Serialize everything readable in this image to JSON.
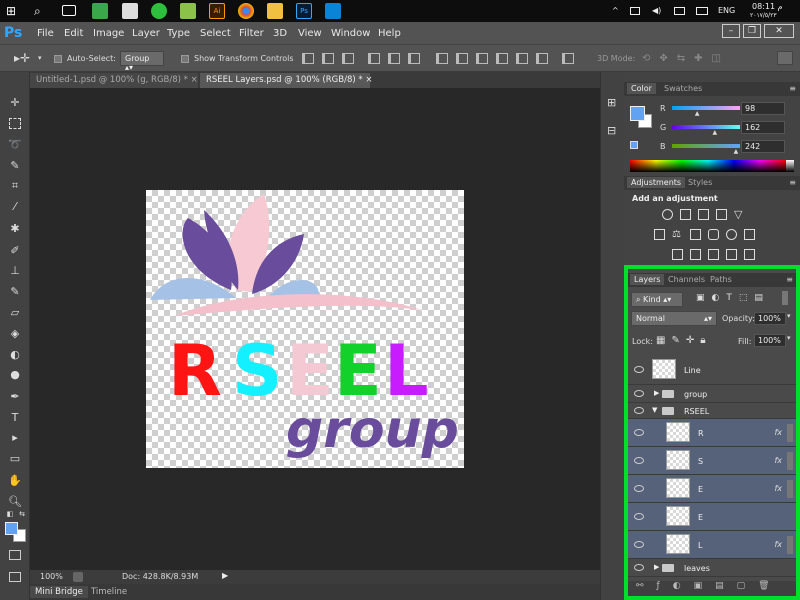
{
  "taskbar": {
    "icons": [
      "windows-icon",
      "search-icon",
      "task-view-icon",
      "folder-icon",
      "calculator-icon",
      "whatsapp-icon",
      "paint-icon",
      "illustrator-icon",
      "chrome-icon",
      "explorer-icon",
      "photoshop-icon",
      "photos-icon"
    ],
    "language": "ENG",
    "time": "08:11 م",
    "date": "٢٠١٧/٥/٢٣"
  },
  "menu": {
    "logo": "Ps",
    "items": [
      "File",
      "Edit",
      "Image",
      "Layer",
      "Type",
      "Select",
      "Filter",
      "3D",
      "View",
      "Window",
      "Help"
    ]
  },
  "options": {
    "auto_select_label": "Auto-Select:",
    "auto_select_value": "Group",
    "show_transform_label": "Show Transform Controls",
    "mode_3d_label": "3D Mode:"
  },
  "tabs": [
    {
      "label": "Untitled-1.psd @ 100% (g, RGB/8) *",
      "active": false
    },
    {
      "label": "RSEEL Layers.psd @ 100% (RGB/8) *",
      "active": true
    }
  ],
  "artwork": {
    "letters": [
      {
        "char": "R",
        "color": "#ff1414"
      },
      {
        "char": "S",
        "color": "#14f0ff"
      },
      {
        "char": "E",
        "color": "#f4c9d3"
      },
      {
        "char": "E",
        "color": "#12d12a"
      },
      {
        "char": "L",
        "color": "#c81cff"
      }
    ],
    "subtitle": "group",
    "subtitle_color": "#6a4c9c",
    "petal_colors": [
      "#6a4c9c",
      "#f7cad3",
      "#a6c1e6"
    ]
  },
  "status": {
    "zoom": "100%",
    "doc": "Doc: 428.8K/8.93M"
  },
  "bottom_tabs": [
    "Mini Bridge",
    "Timeline"
  ],
  "color_panel": {
    "tabs": [
      "Color",
      "Swatches"
    ],
    "fg_color": "#62a2f2",
    "channels": [
      {
        "label": "R",
        "value": "98",
        "fraction": 0.38
      },
      {
        "label": "G",
        "value": "162",
        "fraction": 0.64
      },
      {
        "label": "B",
        "value": "242",
        "fraction": 0.95
      }
    ]
  },
  "adjustments": {
    "tabs": [
      "Adjustments",
      "Styles"
    ],
    "title": "Add an adjustment"
  },
  "layers": {
    "tabs": [
      "Layers",
      "Channels",
      "Paths"
    ],
    "filter_kind": "Kind",
    "blend_mode": "Normal",
    "opacity_label": "Opacity:",
    "opacity": "100%",
    "lock_label": "Lock:",
    "fill_label": "Fill:",
    "fill": "100%",
    "rows": [
      {
        "name": "Line",
        "type": "layer",
        "indent": 0,
        "selected": false,
        "fx": false
      },
      {
        "name": "group",
        "type": "group-closed",
        "indent": 0,
        "selected": false,
        "fx": false
      },
      {
        "name": "RSEEL",
        "type": "group-open",
        "indent": 0,
        "selected": false,
        "fx": false
      },
      {
        "name": "R",
        "type": "layer",
        "indent": 1,
        "selected": true,
        "fx": true
      },
      {
        "name": "S",
        "type": "layer",
        "indent": 1,
        "selected": true,
        "fx": true
      },
      {
        "name": "E",
        "type": "layer",
        "indent": 1,
        "selected": true,
        "fx": true
      },
      {
        "name": "E",
        "type": "layer",
        "indent": 1,
        "selected": true,
        "fx": false
      },
      {
        "name": "L",
        "type": "layer",
        "indent": 1,
        "selected": true,
        "fx": true
      },
      {
        "name": "leaves",
        "type": "group-closed",
        "indent": 0,
        "selected": false,
        "fx": false
      }
    ],
    "fx_label": "fx",
    "highlight_color": "#00e02a"
  }
}
